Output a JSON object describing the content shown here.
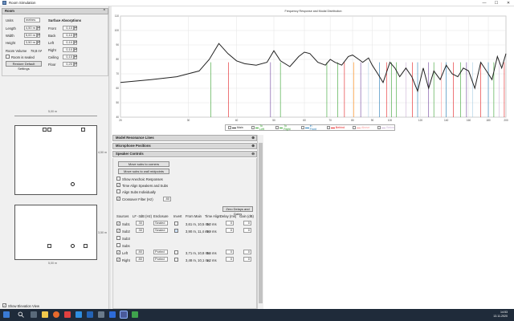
{
  "window": {
    "title": "Room Simulation",
    "minimize": "—",
    "maximize": "☐",
    "close": "✕"
  },
  "room": {
    "header": "Room",
    "units_label": "Units",
    "units_value": "metres",
    "length_label": "Length",
    "length_value": "4,50 m",
    "width_label": "Width",
    "width_value": "5,00 m",
    "height_label": "Height",
    "height_value": "3,50 m",
    "volume_label": "Room Volume",
    "volume_value": "78,8 m³",
    "sealed_label": "Room is sealed",
    "restore_label": "Restore Default Settings",
    "surface_header": "Surface Absorptions",
    "surfaces": [
      {
        "label": "Front",
        "value": "0,10"
      },
      {
        "label": "Back",
        "value": "0,10"
      },
      {
        "label": "Left",
        "value": "0,10"
      },
      {
        "label": "Right",
        "value": "0,10"
      },
      {
        "label": "Ceiling",
        "value": "0,10"
      },
      {
        "label": "Floor",
        "value": "0,20"
      }
    ]
  },
  "plan": {
    "width_dim": "5,00 m",
    "depth_dim": "4,50 m",
    "height_dim": "3,50 m",
    "bottom_dim": "5,00 m"
  },
  "show_elevation": "Show Elevation View",
  "chart_data": {
    "type": "line",
    "title": "Frequency Response and Modal Distribution",
    "x_scale": "log",
    "xlim": [
      20,
      200
    ],
    "ylim": [
      40,
      110
    ],
    "x_ticks": [
      20,
      30,
      40,
      50,
      60,
      70,
      80,
      90,
      100,
      120,
      140,
      160,
      180,
      200
    ],
    "y_ticks": [
      40,
      50,
      60,
      70,
      80,
      90,
      100,
      110
    ],
    "series": [
      {
        "name": "Main",
        "color": "#222222",
        "x": [
          20,
          24,
          28,
          32,
          34,
          36,
          38,
          40,
          42,
          45,
          48,
          50,
          52,
          55,
          58,
          60,
          62,
          65,
          68,
          70,
          72,
          75,
          78,
          80,
          83,
          85,
          88,
          90,
          93,
          96,
          100,
          103,
          106,
          110,
          114,
          118,
          122,
          126,
          130,
          135,
          140,
          145,
          150,
          155,
          160,
          166,
          172,
          178,
          184,
          190,
          195,
          200
        ],
        "y": [
          64,
          66,
          68,
          72,
          80,
          91,
          84,
          79,
          77,
          76,
          78,
          86,
          79,
          75,
          82,
          85,
          84,
          78,
          76,
          80,
          78,
          76,
          82,
          83,
          80,
          78,
          81,
          76,
          70,
          64,
          78,
          74,
          68,
          74,
          68,
          58,
          74,
          60,
          72,
          66,
          76,
          70,
          68,
          74,
          72,
          60,
          78,
          72,
          66,
          82,
          74,
          84
        ]
      }
    ],
    "modal_lines": [
      {
        "x": 34.3,
        "color": "#33a02c"
      },
      {
        "x": 38.1,
        "color": "#e31a1c"
      },
      {
        "x": 49,
        "color": "#6a3d9a"
      },
      {
        "x": 52.0,
        "color": "#33a02c"
      },
      {
        "x": 68.6,
        "color": "#33a02c"
      },
      {
        "x": 73.2,
        "color": "#33a02c"
      },
      {
        "x": 76.2,
        "color": "#e31a1c"
      },
      {
        "x": 80.5,
        "color": "#ff7f00"
      },
      {
        "x": 84.0,
        "color": "#6a3d9a"
      },
      {
        "x": 88.0,
        "color": "#a6cee3"
      },
      {
        "x": 94.0,
        "color": "#1f78b4"
      },
      {
        "x": 98.0,
        "color": "#e31a1c"
      },
      {
        "x": 101.0,
        "color": "#33a02c"
      },
      {
        "x": 104.0,
        "color": "#33a02c"
      },
      {
        "x": 110.0,
        "color": "#cab2d6"
      },
      {
        "x": 114.3,
        "color": "#e31a1c"
      },
      {
        "x": 118.0,
        "color": "#1f78b4"
      },
      {
        "x": 126.0,
        "color": "#6a3d9a"
      },
      {
        "x": 130.0,
        "color": "#33a02c"
      },
      {
        "x": 136.0,
        "color": "#fb9a99"
      },
      {
        "x": 140.0,
        "color": "#1f78b4"
      },
      {
        "x": 146.0,
        "color": "#e31a1c"
      },
      {
        "x": 152.4,
        "color": "#33a02c"
      },
      {
        "x": 158.0,
        "color": "#6a3d9a"
      },
      {
        "x": 164.0,
        "color": "#a6cee3"
      },
      {
        "x": 172.0,
        "color": "#e31a1c"
      },
      {
        "x": 180.0,
        "color": "#1f78b4"
      },
      {
        "x": 186.0,
        "color": "#33a02c"
      },
      {
        "x": 192.0,
        "color": "#cab2d6"
      },
      {
        "x": 198.0,
        "color": "#e31a1c"
      }
    ],
    "legend": [
      {
        "label": "Main",
        "color": "#222222",
        "checked": true
      },
      {
        "label": "To Left",
        "color": "#33a02c",
        "checked": false
      },
      {
        "label": "To Right",
        "color": "#33a02c",
        "checked": false
      },
      {
        "label": "In Front",
        "color": "#1f78b4",
        "checked": false
      },
      {
        "label": "Behind",
        "color": "#e31a1c",
        "checked": false
      },
      {
        "label": "Above",
        "color": "#fb9a99",
        "checked": false
      },
      {
        "label": "Below",
        "color": "#cab2d6",
        "checked": false
      }
    ]
  },
  "sections": {
    "modal": "Model Resonance Lines",
    "mic": "Microphone Positions",
    "speaker": "Speaker Controls"
  },
  "speaker_controls": {
    "move_corners": "Move subs to corners",
    "move_midpoints": "Move subs to wall midpoints",
    "show_anechoic": "Show Anechoic Responses",
    "time_align": "Time Align Speakers and Subs",
    "align_subs": "Align Subs Individually",
    "crossover_label": "Crossover Filter (Hz)",
    "crossover_value": "80",
    "zero_delays": "Zero Delays and Gains",
    "columns": [
      "Sources",
      "LF -3dB (Hz)",
      "Enclosure",
      "Invert",
      "From Main",
      "Time Align",
      "Delay (ms)",
      "Gain (dB)"
    ],
    "rows": [
      {
        "name": "Sub1",
        "checked": true,
        "lf": "30",
        "enclosure": "Sealed",
        "from_main": "3,61 m, 10,5 ms",
        "time_align": "0,0 ms",
        "delay": "0",
        "gain": "0"
      },
      {
        "name": "Sub2",
        "checked": true,
        "lf": "30",
        "enclosure": "Sealed",
        "from_main": "3,90 m, 11,4 ms",
        "time_align": "0,9 ms",
        "delay": "0",
        "gain": "0"
      },
      {
        "name": "Sub3",
        "checked": false,
        "lf": "",
        "enclosure": "",
        "from_main": "",
        "time_align": "",
        "delay": "",
        "gain": ""
      },
      {
        "name": "Subs",
        "checked": false,
        "lf": "",
        "enclosure": "",
        "from_main": "",
        "time_align": "",
        "delay": "",
        "gain": ""
      },
      {
        "name": "Left",
        "checked": true,
        "lf": "80",
        "enclosure": "Ported",
        "from_main": "3,71 m, 10,8 ms",
        "time_align": "0,6 ms",
        "delay": "0",
        "gain": "0"
      },
      {
        "name": "Right",
        "checked": true,
        "lf": "80",
        "enclosure": "Ported",
        "from_main": "3,48 m, 10,1 ms",
        "time_align": "1,2 ms",
        "delay": "0",
        "gain": "0"
      }
    ]
  },
  "taskbar": {
    "time": "14:53",
    "date": "13.11.2020"
  }
}
